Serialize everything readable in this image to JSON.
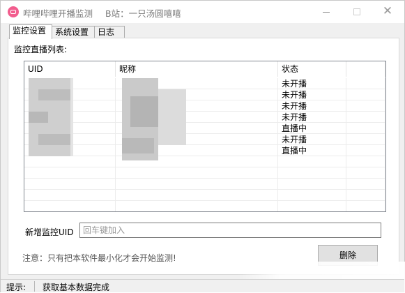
{
  "window": {
    "title": "哔哩哔哩开播监测",
    "subtitle": "B站：一只汤圆嘻嘻"
  },
  "tabs": [
    {
      "label": "监控设置",
      "active": true
    },
    {
      "label": "系统设置",
      "active": false
    },
    {
      "label": "日志",
      "active": false
    }
  ],
  "monitor": {
    "list_label": "监控直播列表:",
    "columns": [
      "UID",
      "昵称",
      "状态",
      ""
    ],
    "rows": [
      {
        "status": "未开播"
      },
      {
        "status": "未开播"
      },
      {
        "status": "未开播"
      },
      {
        "status": "未开播"
      },
      {
        "status": "直播中"
      },
      {
        "status": "未开播"
      },
      {
        "status": "直播中"
      }
    ],
    "add_label": "新增监控UID",
    "add_placeholder": "回车键加入",
    "notice": "注意：只有把本软件最小化才会开始监测!",
    "delete_label": "删除"
  },
  "statusbar": {
    "label": "提示:",
    "text": "获取基本数据完成"
  },
  "colors": {
    "app_icon": "#f25d8e",
    "window_bg": "#f0f0f0",
    "blur": "#c9c9c9"
  }
}
